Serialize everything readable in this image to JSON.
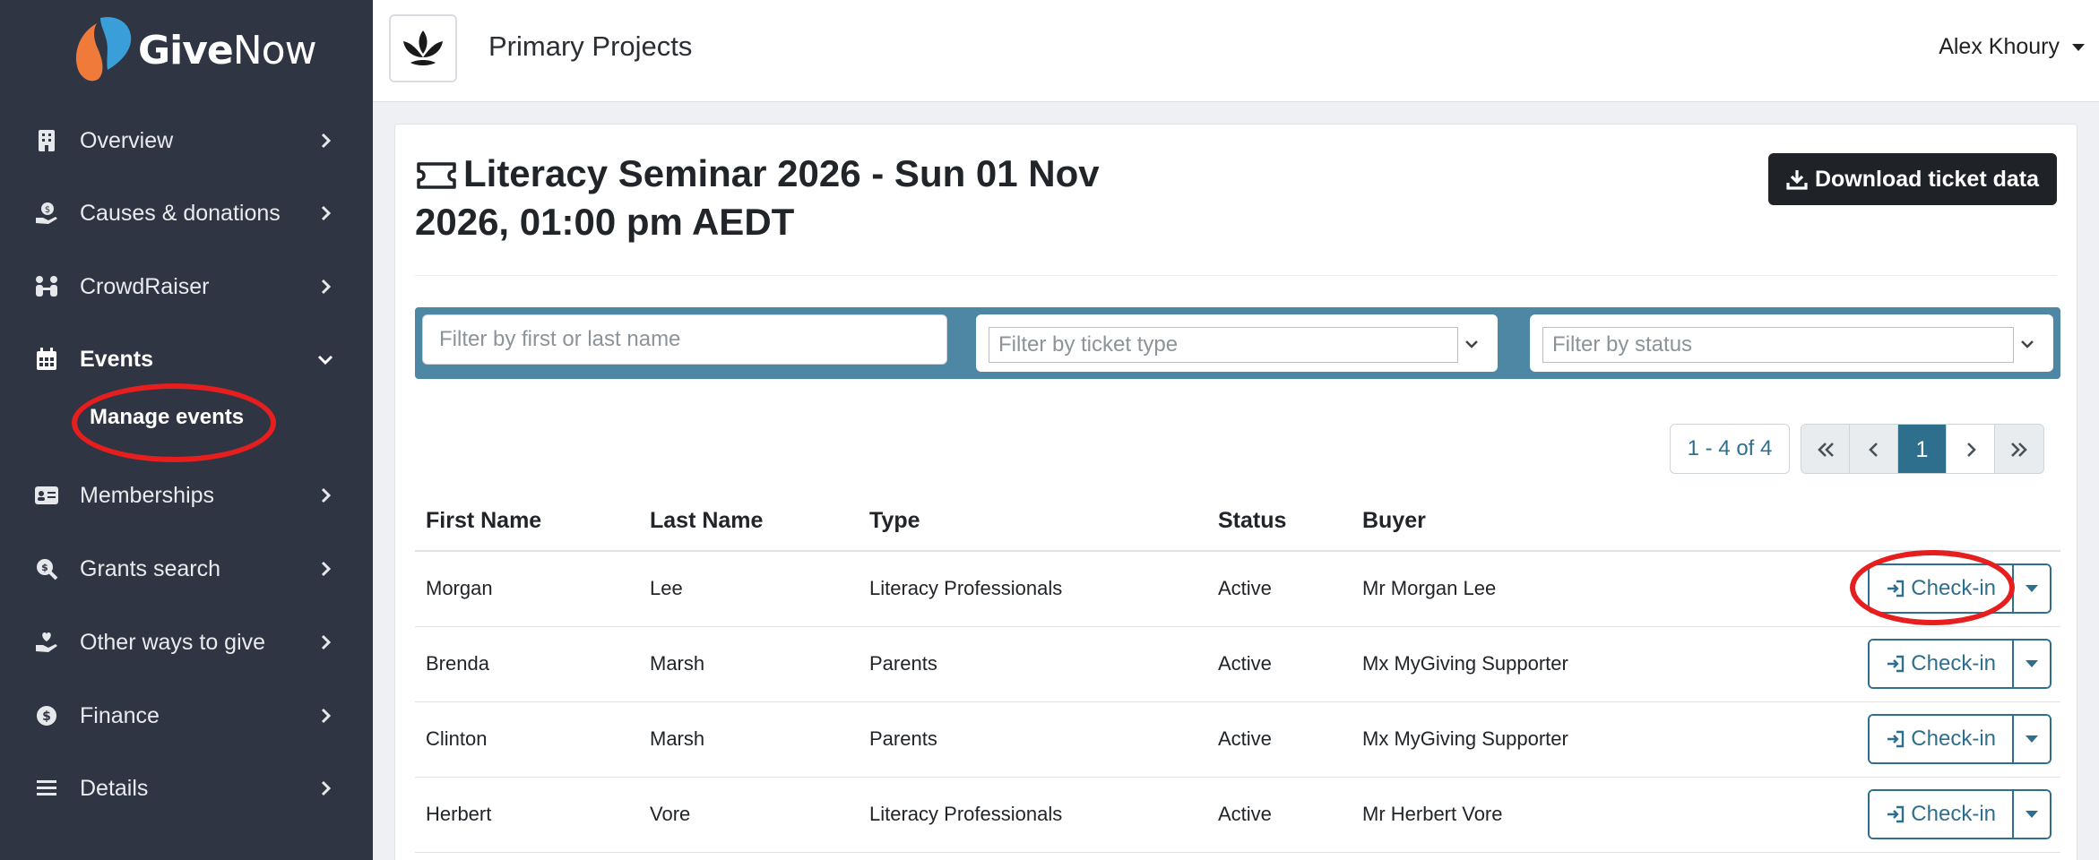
{
  "brand": {
    "logo_bold": "Give",
    "logo_light": "Now"
  },
  "sidebar": {
    "items": [
      {
        "label": "Overview",
        "icon": "building-icon"
      },
      {
        "label": "Causes & donations",
        "icon": "donation-hand-icon"
      },
      {
        "label": "CrowdRaiser",
        "icon": "people-icon"
      },
      {
        "label": "Events",
        "icon": "calendar-icon",
        "active": true
      },
      {
        "label": "Memberships",
        "icon": "id-card-icon"
      },
      {
        "label": "Grants search",
        "icon": "search-dollar-icon"
      },
      {
        "label": "Other ways to give",
        "icon": "hand-heart-icon"
      },
      {
        "label": "Finance",
        "icon": "dollar-circle-icon"
      },
      {
        "label": "Details",
        "icon": "list-icon"
      }
    ],
    "subitem": "Manage events"
  },
  "header": {
    "org_name": "Primary Projects",
    "user_name": "Alex Khoury"
  },
  "page": {
    "title": "Literacy Seminar 2026 - Sun 01 Nov 2026, 01:00 pm AEDT",
    "download_label": "Download ticket data"
  },
  "filters": {
    "name_placeholder": "Filter by first or last name",
    "ticket_type_placeholder": "Filter by ticket type",
    "status_placeholder": "Filter by status"
  },
  "pagination": {
    "range": "1 - 4 of 4",
    "current_page": "1"
  },
  "table": {
    "columns": [
      "First Name",
      "Last Name",
      "Type",
      "Status",
      "Buyer"
    ],
    "rows": [
      {
        "first": "Morgan",
        "last": "Lee",
        "type": "Literacy Professionals",
        "status": "Active",
        "buyer": "Mr Morgan Lee"
      },
      {
        "first": "Brenda",
        "last": "Marsh",
        "type": "Parents",
        "status": "Active",
        "buyer": "Mx MyGiving Supporter"
      },
      {
        "first": "Clinton",
        "last": "Marsh",
        "type": "Parents",
        "status": "Active",
        "buyer": "Mx MyGiving Supporter"
      },
      {
        "first": "Herbert",
        "last": "Vore",
        "type": "Literacy Professionals",
        "status": "Active",
        "buyer": "Mr Herbert Vore"
      }
    ],
    "action_label": "Check-in"
  },
  "colors": {
    "sidebar": "#2f3542",
    "accent": "#2f6f8e",
    "filter_bar": "#4e87a3",
    "highlight": "#e61e1e",
    "logo_orange": "#f07a3a",
    "logo_blue": "#3a9fd8"
  }
}
